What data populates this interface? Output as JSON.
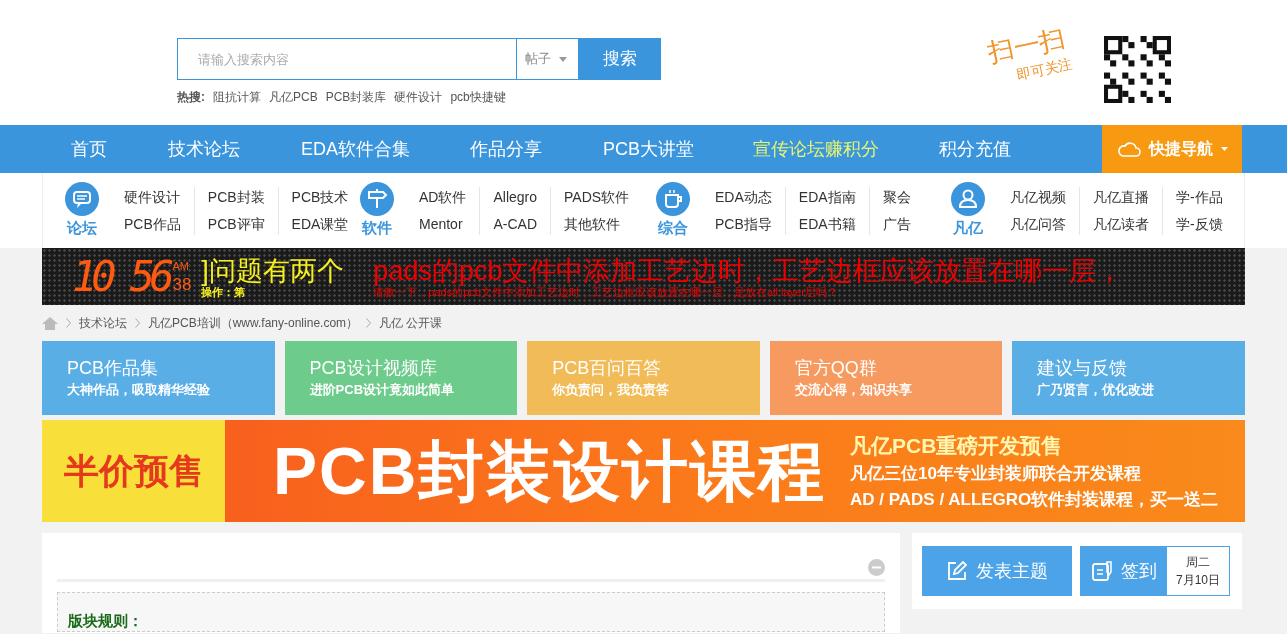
{
  "search": {
    "placeholder": "请输入搜索内容",
    "scope": "帖子",
    "button": "搜索",
    "hot_label": "热搜:",
    "hot_terms": [
      "阻抗计算",
      "凡亿PCB",
      "PCB封装库",
      "硬件设计",
      "pcb快捷键"
    ]
  },
  "qr": {
    "slogan_1": "扫一扫",
    "slogan_2": "即可关注"
  },
  "nav": {
    "items": [
      {
        "label": "首页",
        "highlight": false
      },
      {
        "label": "技术论坛",
        "highlight": false
      },
      {
        "label": "EDA软件合集",
        "highlight": false
      },
      {
        "label": "作品分享",
        "highlight": false
      },
      {
        "label": "PCB大讲堂",
        "highlight": false
      },
      {
        "label": "宣传论坛赚积分",
        "highlight": true
      },
      {
        "label": "积分充值",
        "highlight": false
      }
    ],
    "quick_nav": "快捷导航"
  },
  "subnav": [
    {
      "label": "论坛",
      "links": [
        [
          "硬件设计",
          "PCB作品"
        ],
        [
          "PCB封装",
          "PCB评审"
        ],
        [
          "PCB技术",
          "EDA课堂"
        ]
      ]
    },
    {
      "label": "软件",
      "links": [
        [
          "AD软件",
          "Mentor"
        ],
        [
          "Allegro",
          "A-CAD"
        ],
        [
          "PADS软件",
          "其他软件"
        ]
      ]
    },
    {
      "label": "综合",
      "links": [
        [
          "EDA动态",
          "PCB指导"
        ],
        [
          "EDA指南",
          "EDA书籍"
        ],
        [
          "聚会",
          "广告"
        ]
      ]
    },
    {
      "label": "凡亿",
      "links": [
        [
          "凡亿视频",
          "凡亿问答"
        ],
        [
          "凡亿直播",
          "凡亿读者"
        ],
        [
          "学-作品",
          "学-反馈"
        ]
      ]
    }
  ],
  "ticker": {
    "clock_time": "10 56",
    "clock_ampm": "AM",
    "clock_seconds": "38",
    "yellow_title": "]问题有两个",
    "yellow_sub": "操作：第",
    "red_title": "pads的pcb文件中添加工艺边时，工艺边框应该放置在哪一层，",
    "red_sub": "请教一下，pads的pcb文件中添加工艺边时，工艺边框应该放置在哪一层，是放在all layer层吗？"
  },
  "breadcrumb": [
    "技术论坛",
    "凡亿PCB培训（www.fany-online.com）",
    "凡亿 公开课"
  ],
  "cards": [
    {
      "title": "PCB作品集",
      "subtitle": "大神作品，吸取精华经验",
      "color": "#5aaee6"
    },
    {
      "title": "PCB设计视频库",
      "subtitle": "进阶PCB设计竟如此简单",
      "color": "#6dcb8b"
    },
    {
      "title": "PCB百问百答",
      "subtitle": "你负责问，我负责答",
      "color": "#f1bb58"
    },
    {
      "title": "官方QQ群",
      "subtitle": "交流心得，知识共享",
      "color": "#f79a60"
    },
    {
      "title": "建议与反馈",
      "subtitle": "广乃贤言，优化改进",
      "color": "#5aaee6"
    }
  ],
  "banner": {
    "tag": "半价预售",
    "headline": "PCB封装设计课程",
    "line_1": "凡亿PCB重磅开发预售",
    "line_2": "凡亿三位10年专业封装师联合开发课程",
    "line_3": "AD / PADS / ALLEGRO软件封装课程，买一送二"
  },
  "rules": {
    "heading": "版块规则："
  },
  "actions": {
    "post": "发表主题",
    "checkin": "签到",
    "weekday": "周二",
    "date": "7月10日"
  }
}
